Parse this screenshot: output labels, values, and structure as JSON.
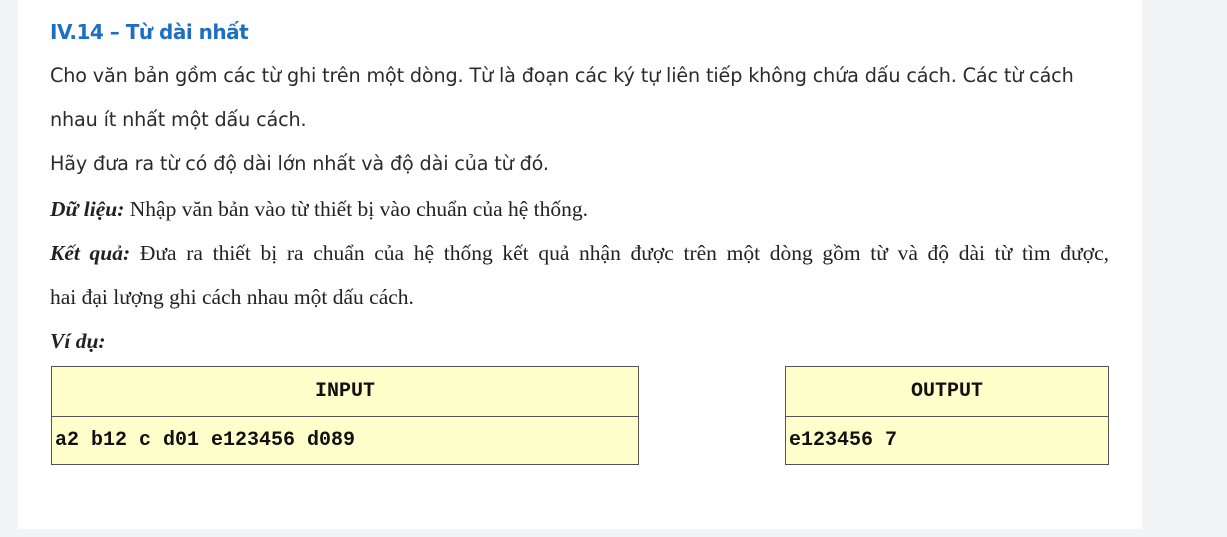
{
  "problem": {
    "title": "IV.14 –  Từ dài nhất",
    "line1": "Cho văn bản gồm các từ ghi trên một dòng. Từ là đoạn các ký tự liên tiếp không chứa dấu cách. Các từ cách",
    "line2": "nhau ít nhất một dấu cách.",
    "line3": "Hãy đưa ra từ có độ dài lớn nhất và độ dài của từ đó.",
    "input_label": "Dữ liệu:",
    "input_text": " Nhập văn bản vào từ thiết bị vào chuẩn của hệ thống.",
    "output_label": "Kết quả:",
    "output_text_line1": " Đưa ra thiết bị ra chuẩn của hệ thống kết quả nhận được trên một dòng gồm từ và độ dài từ tìm được,",
    "output_text_line2": "hai đại lượng ghi cách nhau một dấu cách.",
    "example_label": "Ví dụ:"
  },
  "example": {
    "input_header": "INPUT",
    "input_value": "a2 b12 c d01 e123456 d089",
    "output_header": "OUTPUT",
    "output_value": "e123456 7"
  },
  "colors": {
    "title": "#1d6fc4",
    "table_bg": "#ffffcc",
    "page_bg": "#f3f4f6"
  }
}
